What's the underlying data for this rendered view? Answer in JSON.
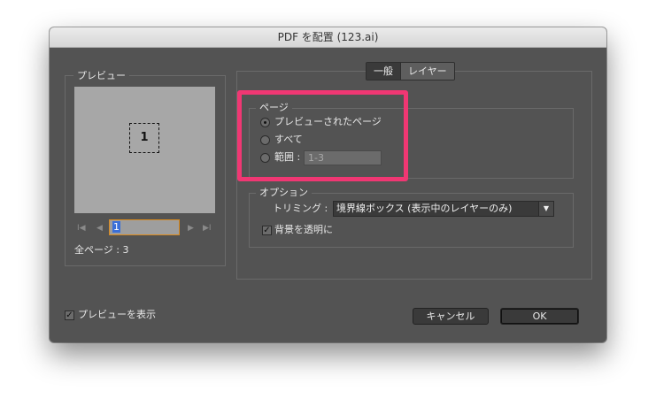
{
  "window": {
    "title": "PDF を配置 (123.ai)"
  },
  "preview": {
    "legend": "プレビュー",
    "page_number": "1",
    "page_input": "1",
    "total_pages": "全ページ : 3",
    "nav": {
      "first": "I◀",
      "prev": "◀",
      "next": "▶",
      "last": "▶I"
    }
  },
  "tabs": [
    {
      "label": "一般",
      "active": true
    },
    {
      "label": "レイヤー",
      "active": false
    }
  ],
  "page_group": {
    "legend": "ページ",
    "options": [
      {
        "label": "プレビューされたページ",
        "selected": true
      },
      {
        "label": "すべて",
        "selected": false
      },
      {
        "label": "範囲 :",
        "selected": false
      }
    ],
    "range_value": "1-3"
  },
  "options_group": {
    "legend": "オプション",
    "crop_label": "トリミング :",
    "crop_value": "境界線ボックス (表示中のレイヤーのみ)",
    "transparent_bg_label": "背景を透明に",
    "transparent_bg_checked": true
  },
  "footer": {
    "show_preview_label": "プレビューを表示",
    "show_preview_checked": true,
    "cancel_label": "キャンセル",
    "ok_label": "OK"
  },
  "colors": {
    "dialog_bg": "#535353",
    "highlight": "#f03773",
    "focus_ring": "#d98a1f",
    "selection": "#3a6fd8"
  }
}
